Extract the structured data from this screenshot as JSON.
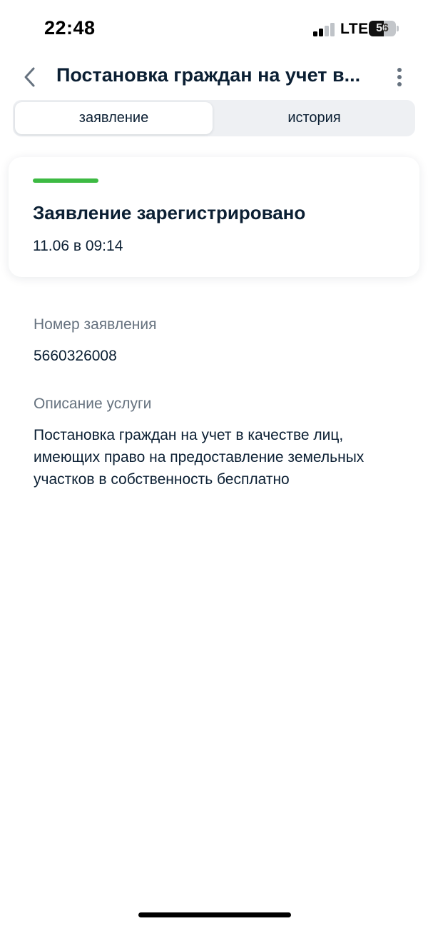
{
  "status_bar": {
    "time": "22:48",
    "network": "LTE",
    "battery_level": "56"
  },
  "header": {
    "back_icon": "chevron-left-icon",
    "title": "Постановка граждан на учет в...",
    "more_icon": "more-vertical-icon"
  },
  "tabs": [
    {
      "label": "заявление",
      "active": true
    },
    {
      "label": "история",
      "active": false
    }
  ],
  "status_card": {
    "title": "Заявление зарегистрировано",
    "date": "11.06 в 09:14",
    "status_color": "#3dba43"
  },
  "details": {
    "number_label": "Номер заявления",
    "number_value": "5660326008",
    "description_label": "Описание услуги",
    "description_value": "Постановка граждан на учет в качестве лиц, имеющих право на предоставление земельных участков в собственность бесплатно"
  },
  "colors": {
    "text_primary": "#0b1f33",
    "text_secondary": "#66727f",
    "accent": "#3dba43"
  }
}
